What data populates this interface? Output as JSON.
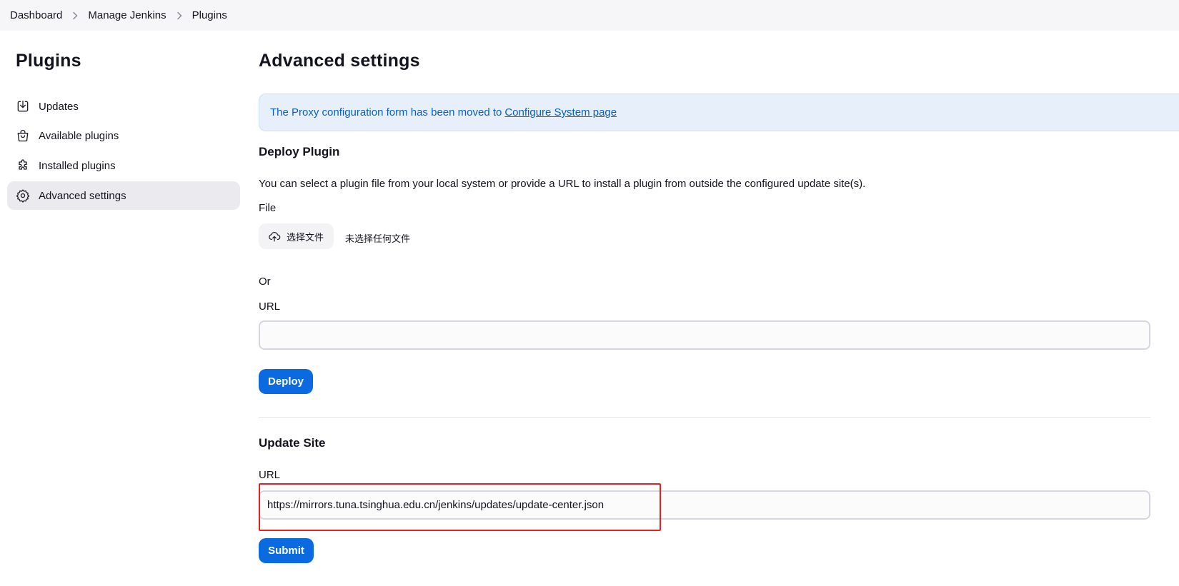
{
  "breadcrumb": {
    "items": [
      "Dashboard",
      "Manage Jenkins",
      "Plugins"
    ]
  },
  "sidebar": {
    "title": "Plugins",
    "items": [
      {
        "label": "Updates",
        "icon": "download-icon"
      },
      {
        "label": "Available plugins",
        "icon": "shopping-bag-icon"
      },
      {
        "label": "Installed plugins",
        "icon": "puzzle-icon"
      },
      {
        "label": "Advanced settings",
        "icon": "gear-icon",
        "active": true
      }
    ]
  },
  "main": {
    "title": "Advanced settings",
    "alert": {
      "text": "The Proxy configuration form has been moved to",
      "link": "Configure System page"
    },
    "deploy": {
      "title": "Deploy Plugin",
      "description": "You can select a plugin file from your local system or provide a URL to install a plugin from outside the configured update site(s).",
      "file_label": "File",
      "file_button": "选择文件",
      "file_status": "未选择任何文件",
      "or_label": "Or",
      "url_label": "URL",
      "url_value": "",
      "deploy_button": "Deploy"
    },
    "update_site": {
      "title": "Update Site",
      "url_label": "URL",
      "url_value": "https://mirrors.tuna.tsinghua.edu.cn/jenkins/updates/update-center.json",
      "submit_button": "Submit"
    }
  },
  "colors": {
    "primary": "#0b6ae0",
    "alert_bg": "#e6effa",
    "alert_text": "#0b5fc4",
    "highlight": "#e8211e",
    "breadcrumb_bg": "#f6f6f8"
  }
}
